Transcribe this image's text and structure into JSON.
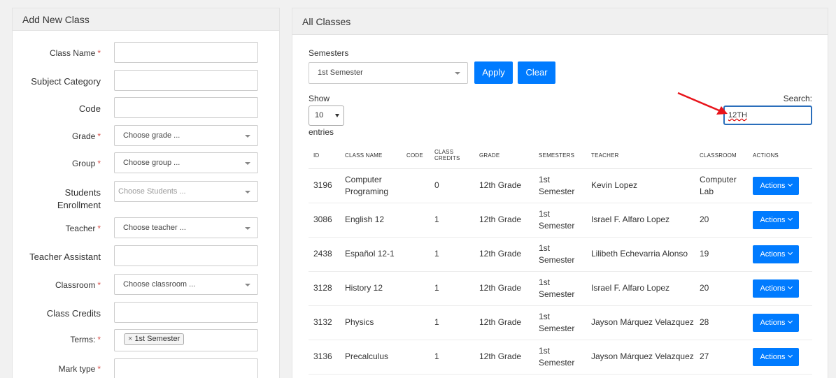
{
  "add_class": {
    "title": "Add New Class",
    "fields": {
      "class_name": "Class Name",
      "subject_category": "Subject Category",
      "code": "Code",
      "grade": "Grade",
      "grade_placeholder": "Choose grade ...",
      "group": "Group",
      "group_placeholder": "Choose group ...",
      "students_enrollment_line1": "Students",
      "students_enrollment_line2": "Enrollment",
      "students_placeholder": "Choose Students ...",
      "teacher": "Teacher",
      "teacher_placeholder": "Choose teacher ...",
      "teacher_assistant": "Teacher Assistant",
      "classroom": "Classroom",
      "classroom_placeholder": "Choose classroom ...",
      "class_credits": "Class Credits",
      "terms": "Terms:",
      "terms_tag": "1st Semester",
      "terms_tag_remove": "×",
      "mark_type": "Mark type",
      "required_mark": "*"
    }
  },
  "all_classes": {
    "title": "All Classes",
    "semesters_label": "Semesters",
    "semester_selected": "1st Semester",
    "apply_label": "Apply",
    "clear_label": "Clear",
    "show_label": "Show",
    "show_value": "10",
    "entries_label": "entries",
    "search_label": "Search:",
    "search_value": "12TH",
    "columns": [
      "ID",
      "CLASS NAME",
      "CODE",
      "CLASS CREDITS",
      "GRADE",
      "SEMESTERS",
      "TEACHER",
      "CLASSROOM",
      "ACTIONS"
    ],
    "actions_label": "Actions",
    "rows": [
      {
        "id": "3196",
        "name": "Computer Programing",
        "code": "",
        "credits": "0",
        "grade": "12th Grade",
        "semesters": "1st Semester",
        "teacher": "Kevin Lopez",
        "classroom": "Computer Lab"
      },
      {
        "id": "3086",
        "name": "English 12",
        "code": "",
        "credits": "1",
        "grade": "12th Grade",
        "semesters": "1st Semester",
        "teacher": "Israel F. Alfaro Lopez",
        "classroom": "20"
      },
      {
        "id": "2438",
        "name": "Español 12-1",
        "code": "",
        "credits": "1",
        "grade": "12th Grade",
        "semesters": "1st Semester",
        "teacher": "Lilibeth Echevarria Alonso",
        "classroom": "19"
      },
      {
        "id": "3128",
        "name": "History 12",
        "code": "",
        "credits": "1",
        "grade": "12th Grade",
        "semesters": "1st Semester",
        "teacher": "Israel F. Alfaro Lopez",
        "classroom": "20"
      },
      {
        "id": "3132",
        "name": "Physics",
        "code": "",
        "credits": "1",
        "grade": "12th Grade",
        "semesters": "1st Semester",
        "teacher": "Jayson Márquez Velazquez",
        "classroom": "28"
      },
      {
        "id": "3136",
        "name": "Precalculus",
        "code": "",
        "credits": "1",
        "grade": "12th Grade",
        "semesters": "1st Semester",
        "teacher": "Jayson Márquez Velazquez",
        "classroom": "27"
      }
    ]
  },
  "colors": {
    "primary": "#007bff",
    "required": "#d9534f",
    "annotation_arrow": "#e8141b"
  }
}
